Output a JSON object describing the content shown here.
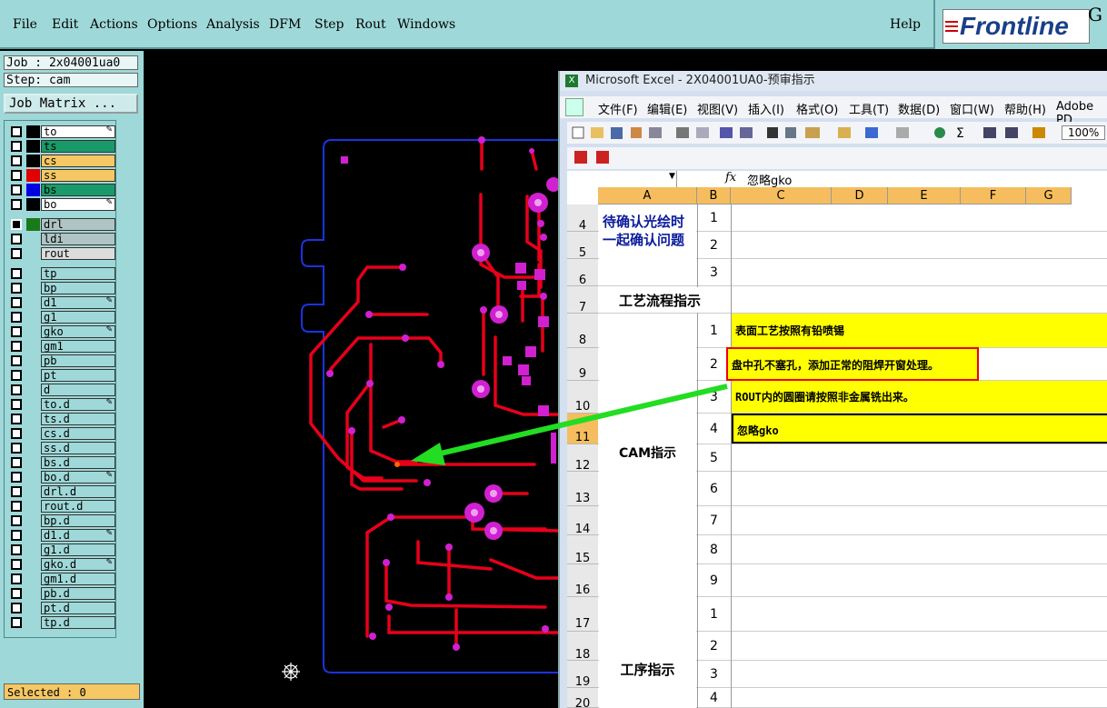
{
  "menu": {
    "items": [
      "File",
      "Edit",
      "Actions",
      "Options",
      "Analysis",
      "DFM",
      "Step",
      "Rout",
      "Windows"
    ],
    "help": "Help"
  },
  "brand": {
    "logo_text": "Frontline",
    "suffix": "G"
  },
  "left": {
    "job_label": "Job : 2x04001ua0",
    "step_label": "Step: cam",
    "job_matrix": "Job Matrix ...",
    "selected": "Selected : 0",
    "layers": [
      {
        "name": "to",
        "bg": "#ffffff",
        "swatch": "#000000"
      },
      {
        "name": "ts",
        "bg": "#1a9a6a",
        "swatch": "#000000"
      },
      {
        "name": "cs",
        "bg": "#f6c863",
        "swatch": "#000000"
      },
      {
        "name": "ss",
        "bg": "#f6c863",
        "swatch": "#e00000"
      },
      {
        "name": "bs",
        "bg": "#1a9a6a",
        "swatch": "#0000e0"
      },
      {
        "name": "bo",
        "bg": "#ffffff",
        "swatch": "#000000"
      },
      {
        "name": "drl",
        "bg": "#b0c4c4",
        "swatch": "#1a7a1a"
      },
      {
        "name": "ldi",
        "bg": "#b0c4c4",
        "swatch": "#9fd8d8"
      },
      {
        "name": "rout",
        "bg": "#dcdcdc",
        "swatch": "#9fd8d8"
      },
      {
        "name": "tp",
        "bg": "#9fd8d8",
        "swatch": "#9fd8d8"
      },
      {
        "name": "bp",
        "bg": "#9fd8d8",
        "swatch": "#9fd8d8"
      },
      {
        "name": "d1",
        "bg": "#9fd8d8",
        "swatch": "#9fd8d8"
      },
      {
        "name": "g1",
        "bg": "#9fd8d8",
        "swatch": "#9fd8d8"
      },
      {
        "name": "gko",
        "bg": "#9fd8d8",
        "swatch": "#9fd8d8"
      },
      {
        "name": "gm1",
        "bg": "#9fd8d8",
        "swatch": "#9fd8d8"
      },
      {
        "name": "pb",
        "bg": "#9fd8d8",
        "swatch": "#9fd8d8"
      },
      {
        "name": "pt",
        "bg": "#9fd8d8",
        "swatch": "#9fd8d8"
      },
      {
        "name": "d",
        "bg": "#9fd8d8",
        "swatch": "#9fd8d8"
      },
      {
        "name": "to.d",
        "bg": "#9fd8d8",
        "swatch": "#9fd8d8"
      },
      {
        "name": "ts.d",
        "bg": "#9fd8d8",
        "swatch": "#9fd8d8"
      },
      {
        "name": "cs.d",
        "bg": "#9fd8d8",
        "swatch": "#9fd8d8"
      },
      {
        "name": "ss.d",
        "bg": "#9fd8d8",
        "swatch": "#9fd8d8"
      },
      {
        "name": "bs.d",
        "bg": "#9fd8d8",
        "swatch": "#9fd8d8"
      },
      {
        "name": "bo.d",
        "bg": "#9fd8d8",
        "swatch": "#9fd8d8"
      },
      {
        "name": "drl.d",
        "bg": "#9fd8d8",
        "swatch": "#9fd8d8"
      },
      {
        "name": "rout.d",
        "bg": "#9fd8d8",
        "swatch": "#9fd8d8"
      },
      {
        "name": "bp.d",
        "bg": "#9fd8d8",
        "swatch": "#9fd8d8"
      },
      {
        "name": "d1.d",
        "bg": "#9fd8d8",
        "swatch": "#9fd8d8"
      },
      {
        "name": "g1.d",
        "bg": "#9fd8d8",
        "swatch": "#9fd8d8"
      },
      {
        "name": "gko.d",
        "bg": "#9fd8d8",
        "swatch": "#9fd8d8"
      },
      {
        "name": "gm1.d",
        "bg": "#9fd8d8",
        "swatch": "#9fd8d8"
      },
      {
        "name": "pb.d",
        "bg": "#9fd8d8",
        "swatch": "#9fd8d8"
      },
      {
        "name": "pt.d",
        "bg": "#9fd8d8",
        "swatch": "#9fd8d8"
      },
      {
        "name": "tp.d",
        "bg": "#9fd8d8",
        "swatch": "#9fd8d8"
      }
    ]
  },
  "excel": {
    "title": "Microsoft Excel - 2X04001UA0-预审指示",
    "menu": [
      "文件(F)",
      "编辑(E)",
      "视图(V)",
      "插入(I)",
      "格式(O)",
      "工具(T)",
      "数据(D)",
      "窗口(W)",
      "帮助(H)",
      "Adobe PD"
    ],
    "zoom": "100%",
    "fx": "fx",
    "formula": "忽略gko",
    "columns": [
      "A",
      "B",
      "C",
      "D",
      "E",
      "F",
      "G"
    ],
    "rows": [
      "4",
      "5",
      "6",
      "7",
      "8",
      "9",
      "10",
      "11",
      "12",
      "13",
      "14",
      "15",
      "16",
      "17",
      "18",
      "19",
      "20"
    ],
    "section1": "待确认光绘时一起确认问题",
    "section_process": "工艺流程指示",
    "section_cam": "CAM指示",
    "section_work": "工序指示",
    "b_nums": [
      "1",
      "2",
      "3",
      "1",
      "2",
      "3",
      "4",
      "5",
      "6",
      "7",
      "8",
      "9",
      "1",
      "2",
      "3",
      "4"
    ],
    "cam_items": [
      "表面工艺按照有铅喷锡",
      "盘中孔不塞孔，添加正常的阻焊开窗处理。",
      "ROUT内的圆圈请按照非金属铣出来。",
      "忽略gko"
    ]
  },
  "colors": {
    "teal": "#9fd8d8",
    "trace": "#e8001a",
    "pad": "#d020d0",
    "outline": "#1a34e0",
    "arrow": "#22dd22",
    "highlight": "#ffff00"
  }
}
